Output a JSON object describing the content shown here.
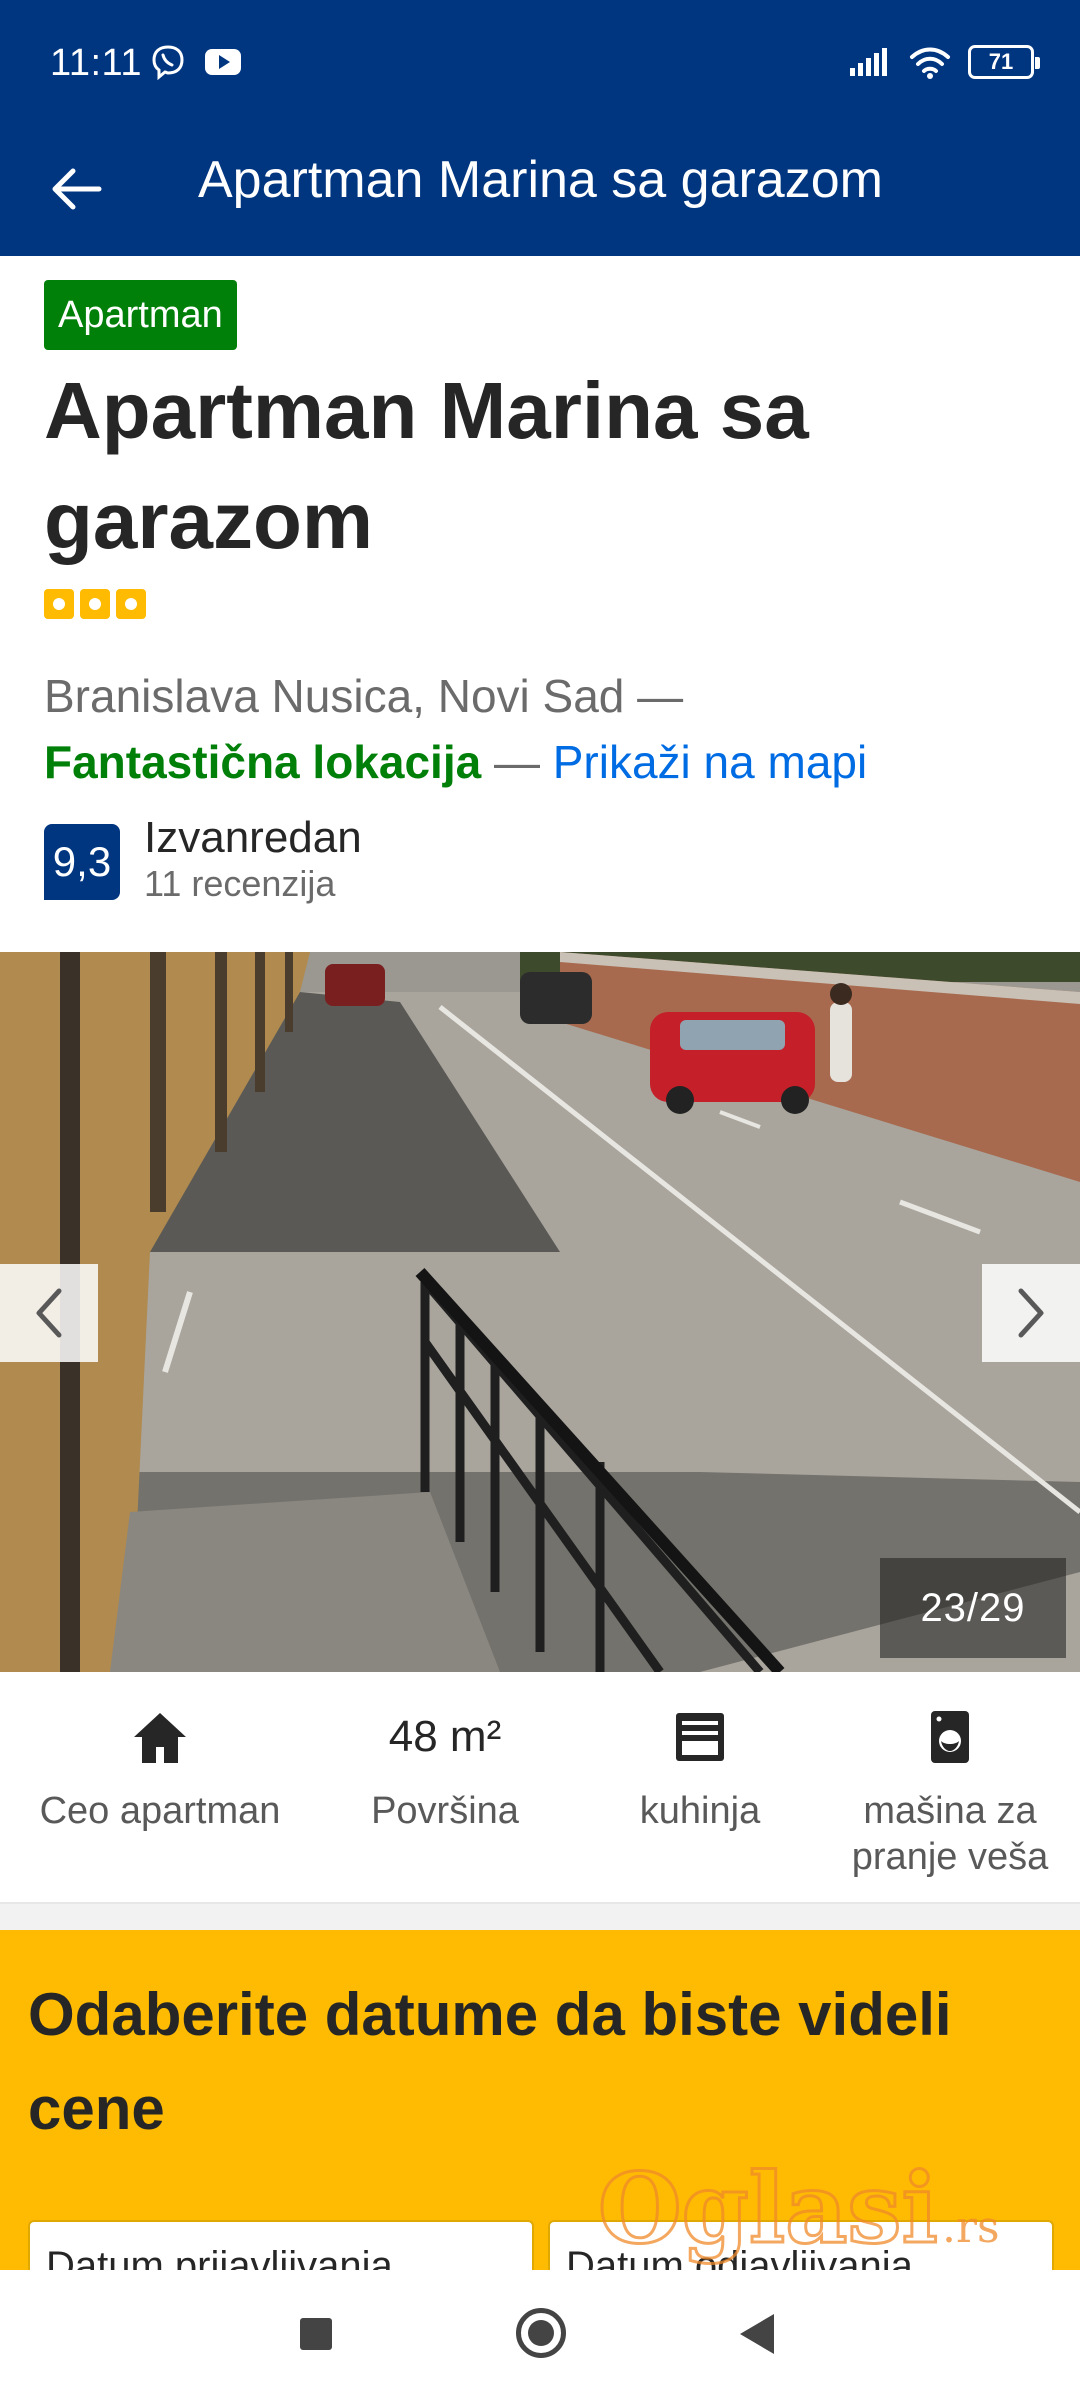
{
  "status_bar": {
    "time": "11:11",
    "battery": "71",
    "icons": [
      "viber-icon",
      "youtube-icon",
      "signal-icon",
      "wifi-icon",
      "battery-icon"
    ]
  },
  "app_bar": {
    "title": "Apartman Marina sa garazom",
    "back_icon": "arrow-left-icon"
  },
  "property": {
    "type_badge": "Apartman",
    "title": "Apartman Marina sa garazom",
    "star_count": 3,
    "address": "Branislava Nusica, Novi Sad —",
    "location_rating": "Fantastična lokacija",
    "location_separator": "—",
    "map_link": "Prikaži na mapi",
    "score": "9,3",
    "score_word": "Izvanredan",
    "review_count": "11 recenzija"
  },
  "gallery": {
    "counter": "23/29",
    "prev_icon": "chevron-left-icon",
    "next_icon": "chevron-right-icon"
  },
  "facilities": [
    {
      "icon": "house-icon",
      "label": "Ceo apartman"
    },
    {
      "value": "48 m²",
      "label": "Površina"
    },
    {
      "icon": "kitchen-icon",
      "label": "kuhinja"
    },
    {
      "icon": "washing-machine-icon",
      "label": "mašina za pranje veša"
    }
  ],
  "dates": {
    "title": "Odaberite datume da biste videli cene",
    "checkin_label": "Datum prijavljivanja",
    "checkout_label": "Datum odjavljivanja"
  },
  "watermark": {
    "text": "Oglasi",
    "suffix": ".rs"
  },
  "colors": {
    "brand_blue": "#003580",
    "green": "#008009",
    "link_blue": "#006ce4",
    "yellow": "#febb02"
  }
}
